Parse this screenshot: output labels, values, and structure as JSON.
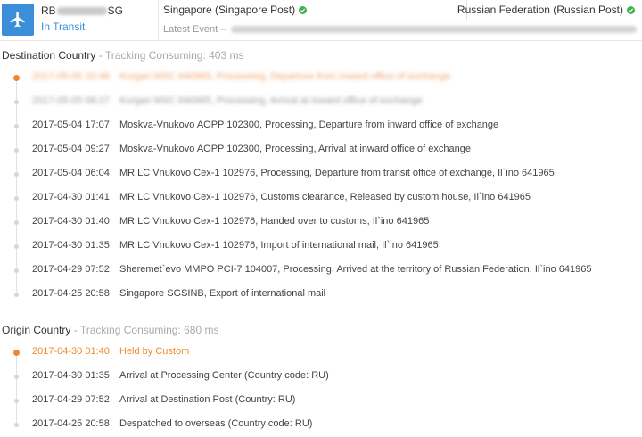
{
  "header": {
    "tracking_prefix": "RB",
    "tracking_suffix": "SG",
    "status": "In Transit",
    "origin": "Singapore (Singapore Post)",
    "destination": "Russian Federation (Russian Post)",
    "latest_event_label": "Latest Event --",
    "icon": "airplane-icon",
    "accent_color": "#3a8fd8",
    "check_color": "#3fb24a"
  },
  "destination_section": {
    "title": "Destination Country",
    "subtitle": "- Tracking Consuming: 403 ms",
    "events": [
      {
        "time": "2017-05-05 10:48",
        "desc": "Kurgan MSC 640965, Processing, Departure from inward office of exchange",
        "active": true,
        "blurred": true
      },
      {
        "time": "2017-05-05 08:27",
        "desc": "Kurgan MSC 640965, Processing, Arrival at inward office of exchange",
        "active": false,
        "blurred": true
      },
      {
        "time": "2017-05-04 17:07",
        "desc": "Moskva-Vnukovo AOPP 102300, Processing, Departure from inward office of exchange",
        "active": false,
        "blurred": false
      },
      {
        "time": "2017-05-04 09:27",
        "desc": "Moskva-Vnukovo AOPP 102300, Processing, Arrival at inward office of exchange",
        "active": false,
        "blurred": false
      },
      {
        "time": "2017-05-04 06:04",
        "desc": "MR LC Vnukovo Cex-1 102976, Processing, Departure from transit office of exchange, Il`ino 641965",
        "active": false,
        "blurred": false
      },
      {
        "time": "2017-04-30 01:41",
        "desc": "MR LC Vnukovo Cex-1 102976, Customs clearance, Released by custom house, Il`ino 641965",
        "active": false,
        "blurred": false
      },
      {
        "time": "2017-04-30 01:40",
        "desc": "MR LC Vnukovo Cex-1 102976, Handed over to customs, Il`ino 641965",
        "active": false,
        "blurred": false
      },
      {
        "time": "2017-04-30 01:35",
        "desc": "MR LC Vnukovo Cex-1 102976, Import of international mail, Il`ino 641965",
        "active": false,
        "blurred": false
      },
      {
        "time": "2017-04-29 07:52",
        "desc": "Sheremet`evo MMPO PCI-7 104007, Processing, Arrived at the territory of Russian Federation, Il`ino 641965",
        "active": false,
        "blurred": false
      },
      {
        "time": "2017-04-25 20:58",
        "desc": "Singapore SGSINB, Export of international mail",
        "active": false,
        "blurred": false
      }
    ]
  },
  "origin_section": {
    "title": "Origin Country",
    "subtitle": "- Tracking Consuming: 680 ms",
    "events": [
      {
        "time": "2017-04-30 01:40",
        "desc": "Held by Custom",
        "active": true,
        "blurred": false
      },
      {
        "time": "2017-04-30 01:35",
        "desc": "Arrival at Processing Center (Country code: RU)",
        "active": false,
        "blurred": false
      },
      {
        "time": "2017-04-29 07:52",
        "desc": "Arrival at Destination Post (Country: RU)",
        "active": false,
        "blurred": false
      },
      {
        "time": "2017-04-25 20:58",
        "desc": "Despatched to overseas (Country code: RU)",
        "active": false,
        "blurred": false
      }
    ]
  }
}
